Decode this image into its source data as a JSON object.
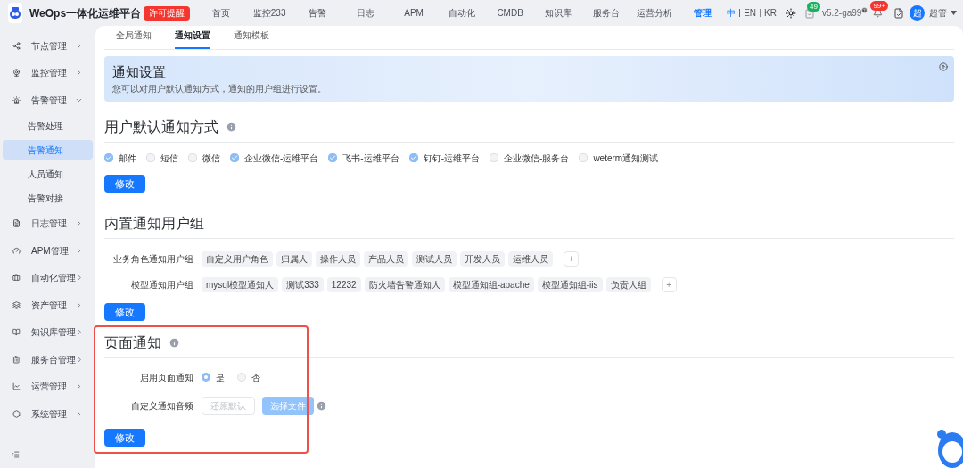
{
  "top_bar": {
    "title": "WeOps一体化运维平台",
    "license_badge": "许可提醒",
    "nav": [
      {
        "label": "首页",
        "selected": false
      },
      {
        "label": "监控233",
        "selected": false
      },
      {
        "label": "告警",
        "selected": false
      },
      {
        "label": "日志",
        "selected": false
      },
      {
        "label": "APM",
        "selected": false
      },
      {
        "label": "自动化",
        "selected": false
      },
      {
        "label": "CMDB",
        "selected": false
      },
      {
        "label": "知识库",
        "selected": false
      },
      {
        "label": "服务台",
        "selected": false
      },
      {
        "label": "运营分析",
        "selected": false
      },
      {
        "label": "管理",
        "selected": true
      }
    ],
    "languages": [
      {
        "label": "中",
        "selected": true
      },
      {
        "label": "EN",
        "selected": false
      },
      {
        "label": "KR",
        "selected": false
      }
    ],
    "task_count": "49",
    "version": "v5.2-ga99",
    "alert_count": "99+",
    "user_avatar": "超",
    "user_name": "超管"
  },
  "sidebar": {
    "items": [
      {
        "label": "节点管理",
        "expanded": false
      },
      {
        "label": "监控管理",
        "expanded": false
      },
      {
        "label": "告警管理",
        "expanded": true,
        "children": [
          {
            "label": "告警处理",
            "selected": false
          },
          {
            "label": "告警通知",
            "selected": true
          },
          {
            "label": "人员通知",
            "selected": false
          },
          {
            "label": "告警对接",
            "selected": false
          }
        ]
      },
      {
        "label": "日志管理",
        "expanded": false
      },
      {
        "label": "APM管理",
        "expanded": false
      },
      {
        "label": "自动化管理",
        "expanded": false
      },
      {
        "label": "资产管理",
        "expanded": false
      },
      {
        "label": "知识库管理",
        "expanded": false
      },
      {
        "label": "服务台管理",
        "expanded": false
      },
      {
        "label": "运营管理",
        "expanded": false
      },
      {
        "label": "系统管理",
        "expanded": false
      }
    ]
  },
  "tabs": [
    {
      "label": "全局通知",
      "selected": false
    },
    {
      "label": "通知设置",
      "selected": true
    },
    {
      "label": "通知模板",
      "selected": false
    }
  ],
  "banner": {
    "title": "通知设置",
    "description": "您可以对用户默认通知方式，通知的用户组进行设置。"
  },
  "default_methods": {
    "title": "用户默认通知方式",
    "options": [
      {
        "label": "邮件",
        "checked": true
      },
      {
        "label": "短信",
        "checked": false
      },
      {
        "label": "微信",
        "checked": false
      },
      {
        "label": "企业微信-运维平台",
        "checked": true
      },
      {
        "label": "飞书-运维平台",
        "checked": true
      },
      {
        "label": "钉钉-运维平台",
        "checked": true
      },
      {
        "label": "企业微信-服务台",
        "checked": false
      },
      {
        "label": "weterm通知测试",
        "checked": false
      }
    ],
    "button": "修改"
  },
  "builtin_groups": {
    "title": "内置通知用户组",
    "rows": [
      {
        "label": "业务角色通知用户组",
        "tags": [
          "自定义用户角色",
          "归属人",
          "操作人员",
          "产品人员",
          "测试人员",
          "开发人员",
          "运维人员"
        ],
        "add": "+"
      },
      {
        "label": "模型通知用户组",
        "tags": [
          "mysql模型通知人",
          "测试333",
          "12232",
          "防火墙告警通知人",
          "模型通知组-apache",
          "模型通知组-iis",
          "负责人组"
        ],
        "add": "+"
      }
    ],
    "button": "修改"
  },
  "page_notification": {
    "title": "页面通知",
    "highlighted": true,
    "enable_label": "启用页面通知",
    "radios": [
      {
        "label": "是",
        "selected": true
      },
      {
        "label": "否",
        "selected": false
      }
    ],
    "audio_label": "自定义通知音频",
    "audio_buttons": [
      {
        "label": "还原默认",
        "kind": "outline",
        "disabled": true
      },
      {
        "label": "选择文件",
        "kind": "primary",
        "disabled": true
      }
    ],
    "button": "修改"
  }
}
